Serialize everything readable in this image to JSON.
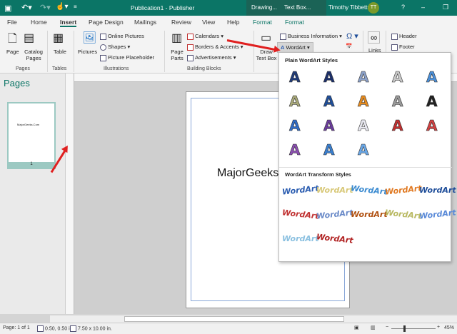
{
  "title_bar": {
    "title": "Publication1  -  Publisher",
    "context_tabs": [
      "Drawing...",
      "Text Box..."
    ],
    "user": "Timothy Tibbetts",
    "initials": "TT",
    "help": "?",
    "brand_color": "#0b7566"
  },
  "tabs": [
    "File",
    "Home",
    "Insert",
    "Page Design",
    "Mailings",
    "Review",
    "View",
    "Help",
    "Format",
    "Format"
  ],
  "active_tab": "Insert",
  "ribbon": {
    "pages": {
      "page": "Page",
      "catalog": "Catalog Pages",
      "group": "Pages"
    },
    "tables": {
      "table": "Table",
      "group": "Tables"
    },
    "illustrations": {
      "pictures": "Pictures",
      "online": "Online Pictures",
      "shapes": "Shapes",
      "placeholder": "Picture Placeholder",
      "group": "Illustrations"
    },
    "building": {
      "parts": "Page Parts",
      "calendars": "Calendars",
      "borders": "Borders & Accents",
      "ads": "Advertisements",
      "group": "Building Blocks"
    },
    "text": {
      "draw": "Draw Text Box",
      "business": "Business Information",
      "wordart": "WordArt",
      "symbol": "Ω"
    },
    "links": "Links",
    "header": "Header",
    "footer": "Footer"
  },
  "pages_pane": {
    "title": "Pages",
    "thumb_text": "MajorGeeks.Com",
    "page_number": "1"
  },
  "document": {
    "text": "MajorGeeks"
  },
  "wordart_menu": {
    "plain_title": "Plain WordArt Styles",
    "plain_glyph": "A",
    "plain_colors": [
      "#1f3a78",
      "#1b2f6b",
      "#8aa0c8",
      "#c8c8c8",
      "#4a8fd8",
      "#a8a878",
      "#1f4e9a",
      "#e58a1e",
      "#9a9a9a",
      "#222222",
      "#2f6cc8",
      "#6a3c9c",
      "#e8e8f0",
      "#c03030",
      "#d04040",
      "#8b4fb0",
      "#3a7fd0",
      "#6aa8e8"
    ],
    "transform_title": "WordArt Transform Styles",
    "transform_text": "WordArt",
    "transform_colors": [
      "#2a5cb0",
      "#d8c878",
      "#3a8ad0",
      "#e07820",
      "#1f4e9a",
      "#c03030",
      "#6a8ac8",
      "#b05010",
      "#b8b860",
      "#5a8ad8",
      "#8ac0e0",
      "#b02020"
    ]
  },
  "status": {
    "page": "Page: 1 of 1",
    "position": "0.50, 0.50 in.",
    "size": "7.50 x 10.00 in.",
    "zoom": "45%"
  }
}
